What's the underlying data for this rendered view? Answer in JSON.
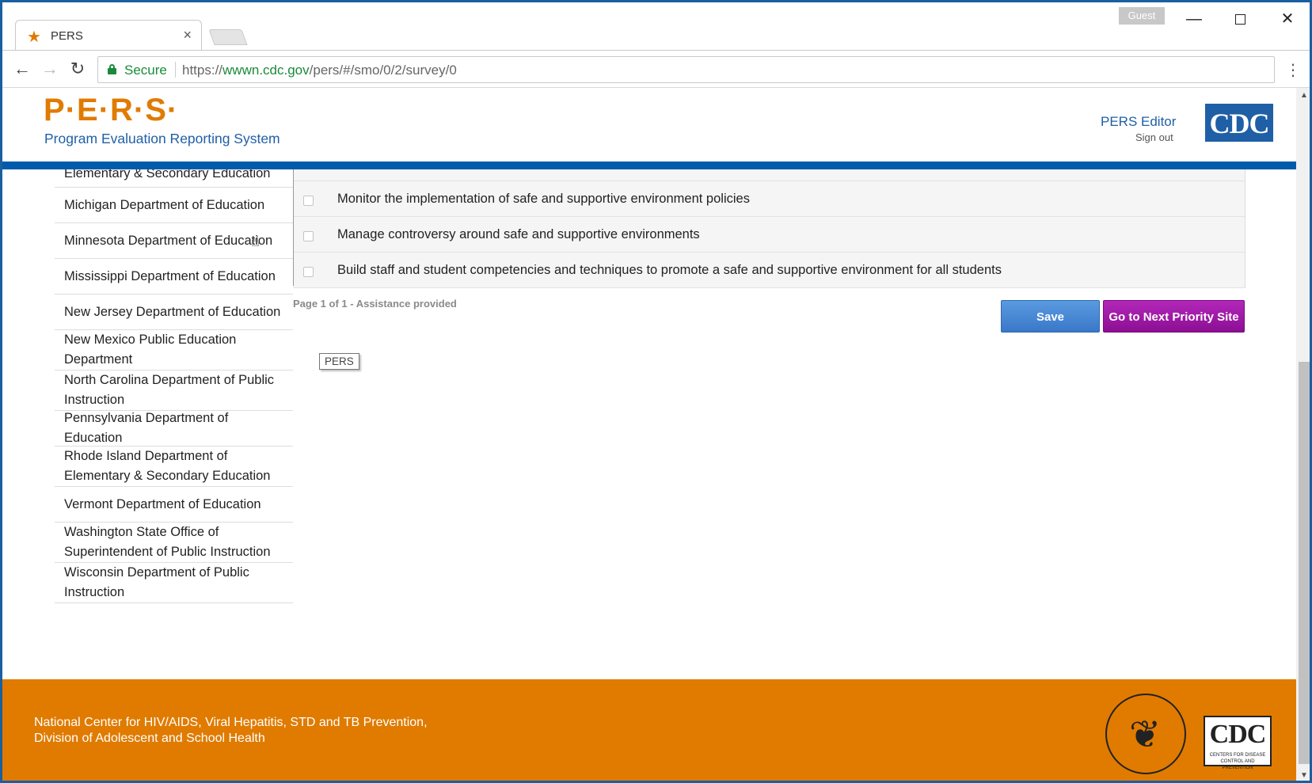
{
  "browser": {
    "tab_title": "PERS",
    "tab_close": "×",
    "profile": "Guest",
    "win_min": "—",
    "win_close": "✕",
    "secure_label": "Secure",
    "url_scheme": "https://",
    "url_host": "wwwn.cdc.gov",
    "url_path": "/pers/#/smo/0/2/survey/0",
    "kebab": "⋮"
  },
  "header": {
    "logo": "P·E·R·S·",
    "subtitle": "Program Evaluation Reporting System",
    "user_name": "PERS Editor",
    "sign_out": "Sign out",
    "cdc_logo": "CDC"
  },
  "sidebar": {
    "items": [
      {
        "label": "Elementary & Secondary Education"
      },
      {
        "label": "Michigan Department of Education"
      },
      {
        "label": "Minnesota Department of Education"
      },
      {
        "label": "Mississippi Department of Education"
      },
      {
        "label": "New Jersey Department of Education"
      },
      {
        "label": "New Mexico Public Education Department"
      },
      {
        "label": "North Carolina Department of Public Instruction"
      },
      {
        "label": "Pennsylvania Department of Education"
      },
      {
        "label": "Rhode Island Department of Elementary & Secondary Education"
      },
      {
        "label": "Vermont Department of Education"
      },
      {
        "label": "Washington State Office of Superintendent of Public Instruction"
      },
      {
        "label": "Wisconsin Department of Public Instruction"
      }
    ]
  },
  "tasks": {
    "rows": [
      {
        "label": "Monitor the implementation of safe and supportive environment policies",
        "checked": false
      },
      {
        "label": "Manage controversy around safe and supportive environments",
        "checked": false
      },
      {
        "label": "Build staff and student competencies and techniques to promote a safe and supportive environment for all students",
        "checked": false
      }
    ]
  },
  "pager": {
    "text": "Page 1 of 1 - Assistance provided"
  },
  "actions": {
    "save_label": "Save",
    "next_label": "Go to Next Priority Site"
  },
  "tooltip": {
    "text": "PERS"
  },
  "footer": {
    "line1": "National Center for HIV/AIDS, Viral Hepatitis, STD and TB Prevention,",
    "line2": "Division of Adolescent and School Health",
    "cdc_logo": "CDC",
    "cdc_small": "CENTERS FOR DISEASE CONTROL AND PREVENTION"
  },
  "colors": {
    "brand_orange": "#e07b00",
    "brand_blue": "#1f5fa6",
    "save_blue": "#3a78c8",
    "next_purple": "#8c0f93"
  }
}
